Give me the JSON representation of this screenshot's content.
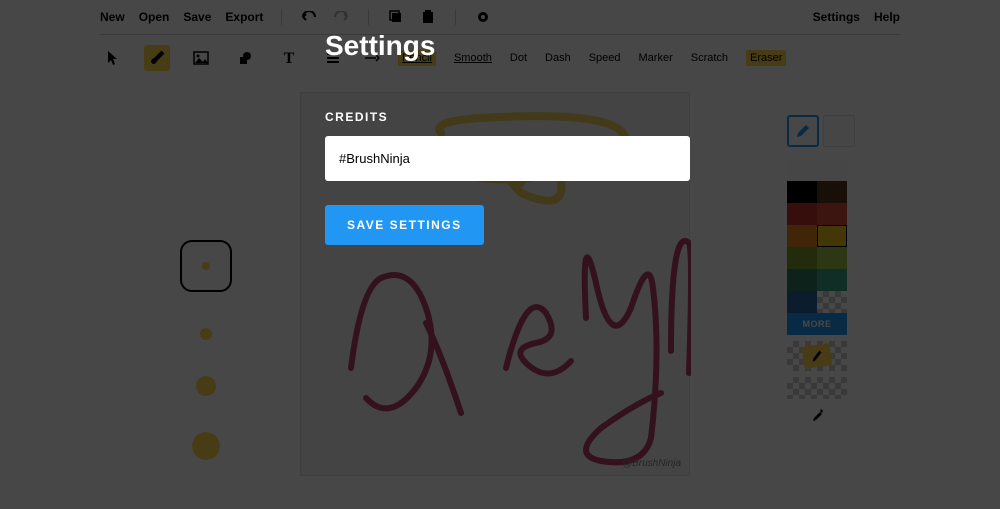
{
  "menu": {
    "new": "New",
    "open": "Open",
    "save": "Save",
    "export": "Export",
    "settings": "Settings",
    "help": "Help"
  },
  "brush_options": {
    "pencil": "Pencil",
    "smooth": "Smooth",
    "dot": "Dot",
    "dash": "Dash",
    "speed": "Speed",
    "marker": "Marker",
    "scratch": "Scratch",
    "eraser": "Eraser"
  },
  "canvas": {
    "watermark": "@BrushNinja"
  },
  "colors": {
    "more": "MORE",
    "swatches": [
      [
        "#fafafa",
        "#fafafa"
      ],
      [
        "#000000",
        "#5a3820"
      ],
      [
        "#c0382b",
        "#d94b3a"
      ],
      [
        "#e98423",
        "#f0c419"
      ],
      [
        "#7a9a2a",
        "#a6c74a"
      ],
      [
        "#2e7a5f",
        "#3da58a"
      ],
      [
        "#2a6aa0",
        "#3b88cc"
      ]
    ]
  },
  "modal": {
    "title": "Settings",
    "credits_label": "CREDITS",
    "credits_value": "#BrushNinja",
    "button": "SAVE SETTINGS"
  }
}
